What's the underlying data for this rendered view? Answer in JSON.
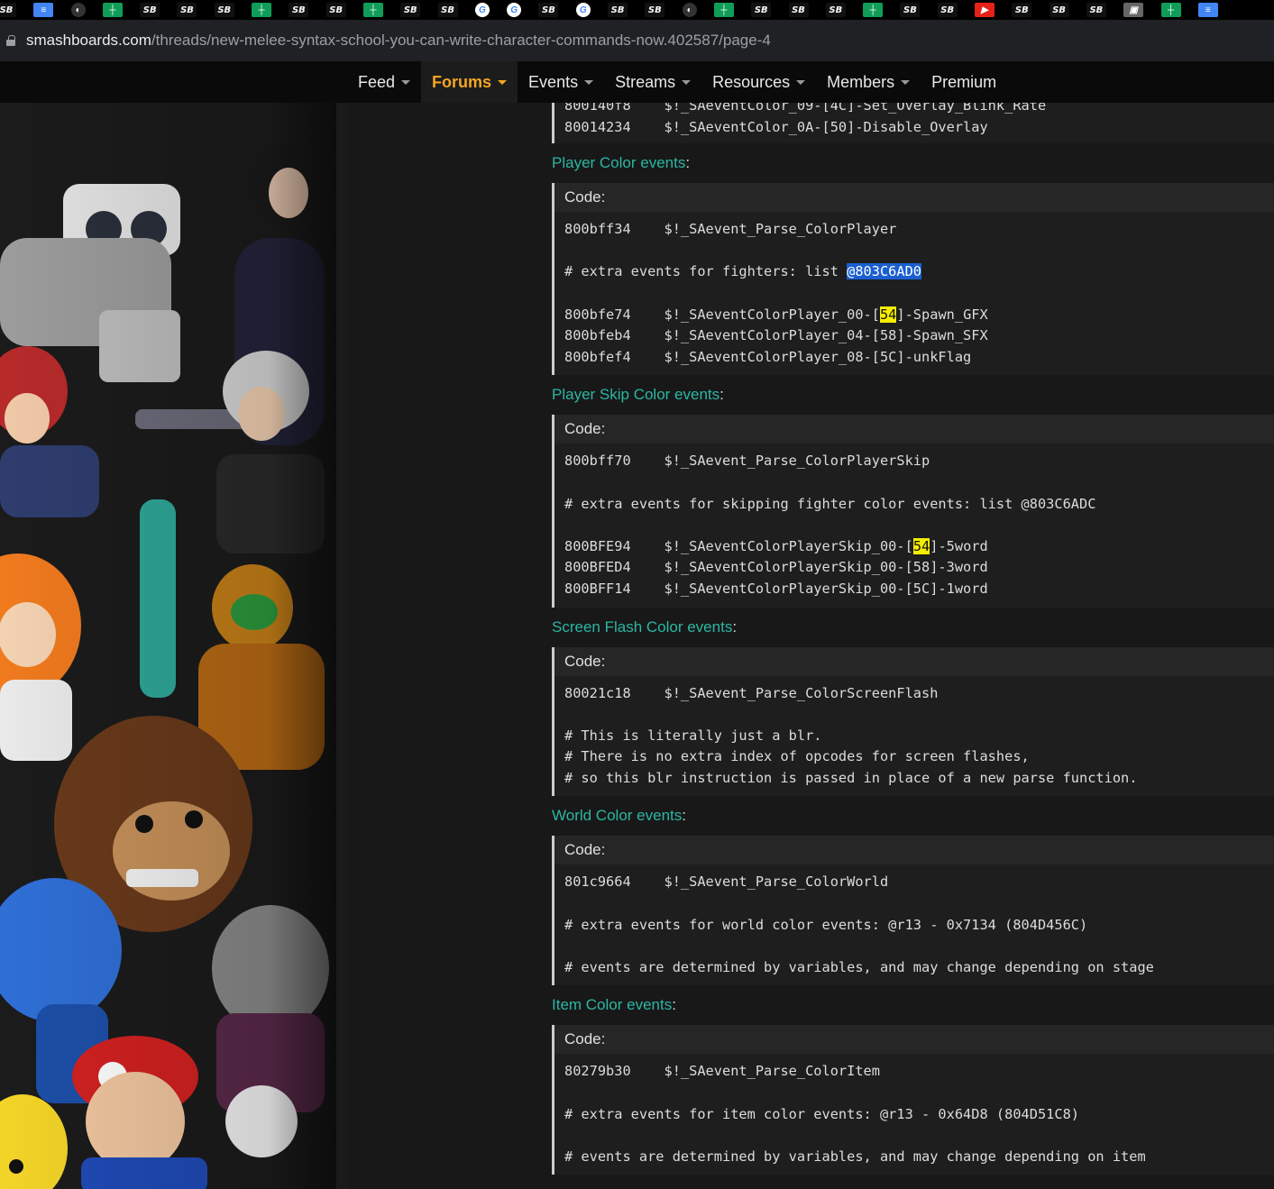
{
  "browser": {
    "bookmarks": [
      {
        "icon": "smashboards-icon",
        "text": "SB"
      },
      {
        "icon": "google-docs-icon",
        "text": ""
      },
      {
        "icon": "globe-icon",
        "text": ""
      },
      {
        "icon": "google-sheets-icon",
        "text": ""
      },
      {
        "icon": "smashboards-icon",
        "text": "SB"
      },
      {
        "icon": "smashboards-icon",
        "text": "SB"
      },
      {
        "icon": "smashboards-icon",
        "text": "SB"
      },
      {
        "icon": "google-sheets-icon",
        "text": ""
      },
      {
        "icon": "smashboards-icon",
        "text": "SB"
      },
      {
        "icon": "smashboards-icon",
        "text": "SB"
      },
      {
        "icon": "google-sheets-icon",
        "text": ""
      },
      {
        "icon": "smashboards-icon",
        "text": "SB"
      },
      {
        "icon": "smashboards-icon",
        "text": "SB"
      },
      {
        "icon": "google-icon",
        "text": ""
      },
      {
        "icon": "google-icon",
        "text": ""
      },
      {
        "icon": "smashboards-icon",
        "text": "SB"
      },
      {
        "icon": "google-icon",
        "text": ""
      },
      {
        "icon": "smashboards-icon",
        "text": "SB"
      },
      {
        "icon": "smashboards-icon",
        "text": "SB"
      },
      {
        "icon": "globe-icon",
        "text": ""
      },
      {
        "icon": "google-sheets-icon",
        "text": ""
      },
      {
        "icon": "smashboards-icon",
        "text": "SB"
      },
      {
        "icon": "smashboards-icon",
        "text": "SB"
      },
      {
        "icon": "smashboards-icon",
        "text": "SB"
      },
      {
        "icon": "google-sheets-icon",
        "text": ""
      },
      {
        "icon": "smashboards-icon",
        "text": "SB"
      },
      {
        "icon": "smashboards-icon",
        "text": "SB"
      },
      {
        "icon": "youtube-icon",
        "text": ""
      },
      {
        "icon": "smashboards-icon",
        "text": "SB"
      },
      {
        "icon": "smashboards-icon",
        "text": "SB"
      },
      {
        "icon": "smashboards-icon",
        "text": "SB"
      },
      {
        "icon": "image-icon",
        "text": ""
      },
      {
        "icon": "google-sheets-icon",
        "text": ""
      },
      {
        "icon": "google-docs-icon",
        "text": ""
      }
    ],
    "url_host": "smashboards.com",
    "url_path": "/threads/new-melee-syntax-school-you-can-write-character-commands-now.402587/page-4"
  },
  "nav": {
    "items": [
      {
        "label": "Feed",
        "dropdown": true,
        "active": false
      },
      {
        "label": "Forums",
        "dropdown": true,
        "active": true
      },
      {
        "label": "Events",
        "dropdown": true,
        "active": false
      },
      {
        "label": "Streams",
        "dropdown": true,
        "active": false
      },
      {
        "label": "Resources",
        "dropdown": true,
        "active": false
      },
      {
        "label": "Members",
        "dropdown": true,
        "active": false
      },
      {
        "label": "Premium",
        "dropdown": false,
        "active": false
      }
    ]
  },
  "post": {
    "partial_top_lines": [
      "800140f8    $!_SAeventColor_09-[4C]-Set_Overlay_Blink_Rate",
      "80014234    $!_SAeventColor_0A-[50]-Disable_Overlay"
    ],
    "sections": [
      {
        "heading": "Player Color events",
        "code_label": "Code:",
        "lines": [
          [
            {
              "t": "800bff34    $!_SAevent_Parse_ColorPlayer"
            }
          ],
          [],
          [
            {
              "t": "# extra events for fighters: list "
            },
            {
              "t": "@803C6AD0",
              "hl": "sel"
            }
          ],
          [],
          [
            {
              "t": "800bfe74    $!_SAeventColorPlayer_00-["
            },
            {
              "t": "54",
              "hl": "yel"
            },
            {
              "t": "]-Spawn_GFX"
            }
          ],
          [
            {
              "t": "800bfeb4    $!_SAeventColorPlayer_04-[58]-Spawn_SFX"
            }
          ],
          [
            {
              "t": "800bfef4    $!_SAeventColorPlayer_08-[5C]-unkFlag"
            }
          ]
        ]
      },
      {
        "heading": "Player Skip Color events",
        "code_label": "Code:",
        "lines": [
          [
            {
              "t": "800bff70    $!_SAevent_Parse_ColorPlayerSkip"
            }
          ],
          [],
          [
            {
              "t": "# extra events for skipping fighter color events: list @803C6ADC"
            }
          ],
          [],
          [
            {
              "t": "800BFE94    $!_SAeventColorPlayerSkip_00-["
            },
            {
              "t": "54",
              "hl": "yel"
            },
            {
              "t": "]-5word"
            }
          ],
          [
            {
              "t": "800BFED4    $!_SAeventColorPlayerSkip_00-[58]-3word"
            }
          ],
          [
            {
              "t": "800BFF14    $!_SAeventColorPlayerSkip_00-[5C]-1word"
            }
          ]
        ]
      },
      {
        "heading": "Screen Flash Color events",
        "code_label": "Code:",
        "lines": [
          [
            {
              "t": "80021c18    $!_SAevent_Parse_ColorScreenFlash"
            }
          ],
          [],
          [
            {
              "t": "# This is literally just a blr."
            }
          ],
          [
            {
              "t": "# There is no extra index of opcodes for screen flashes,"
            }
          ],
          [
            {
              "t": "# so this blr instruction is passed in place of a new parse function."
            }
          ]
        ]
      },
      {
        "heading": "World Color events",
        "code_label": "Code:",
        "lines": [
          [
            {
              "t": "801c9664    $!_SAevent_Parse_ColorWorld"
            }
          ],
          [],
          [
            {
              "t": "# extra events for world color events: @r13 - 0x7134 (804D456C)"
            }
          ],
          [],
          [
            {
              "t": "# events are determined by variables, and may change depending on stage"
            }
          ]
        ]
      },
      {
        "heading": "Item Color events",
        "code_label": "Code:",
        "lines": [
          [
            {
              "t": "80279b30    $!_SAevent_Parse_ColorItem"
            }
          ],
          [],
          [
            {
              "t": "# extra events for item color events: @r13 - 0x64D8 (804D51C8)"
            }
          ],
          [],
          [
            {
              "t": "# events are determined by variables, and may change depending on item"
            }
          ]
        ]
      }
    ]
  },
  "colors": {
    "accent_heading": "#2bb7a3",
    "nav_active": "#f5a623",
    "selection": "#1a5fd0",
    "search_highlight": "#f5ee00"
  }
}
